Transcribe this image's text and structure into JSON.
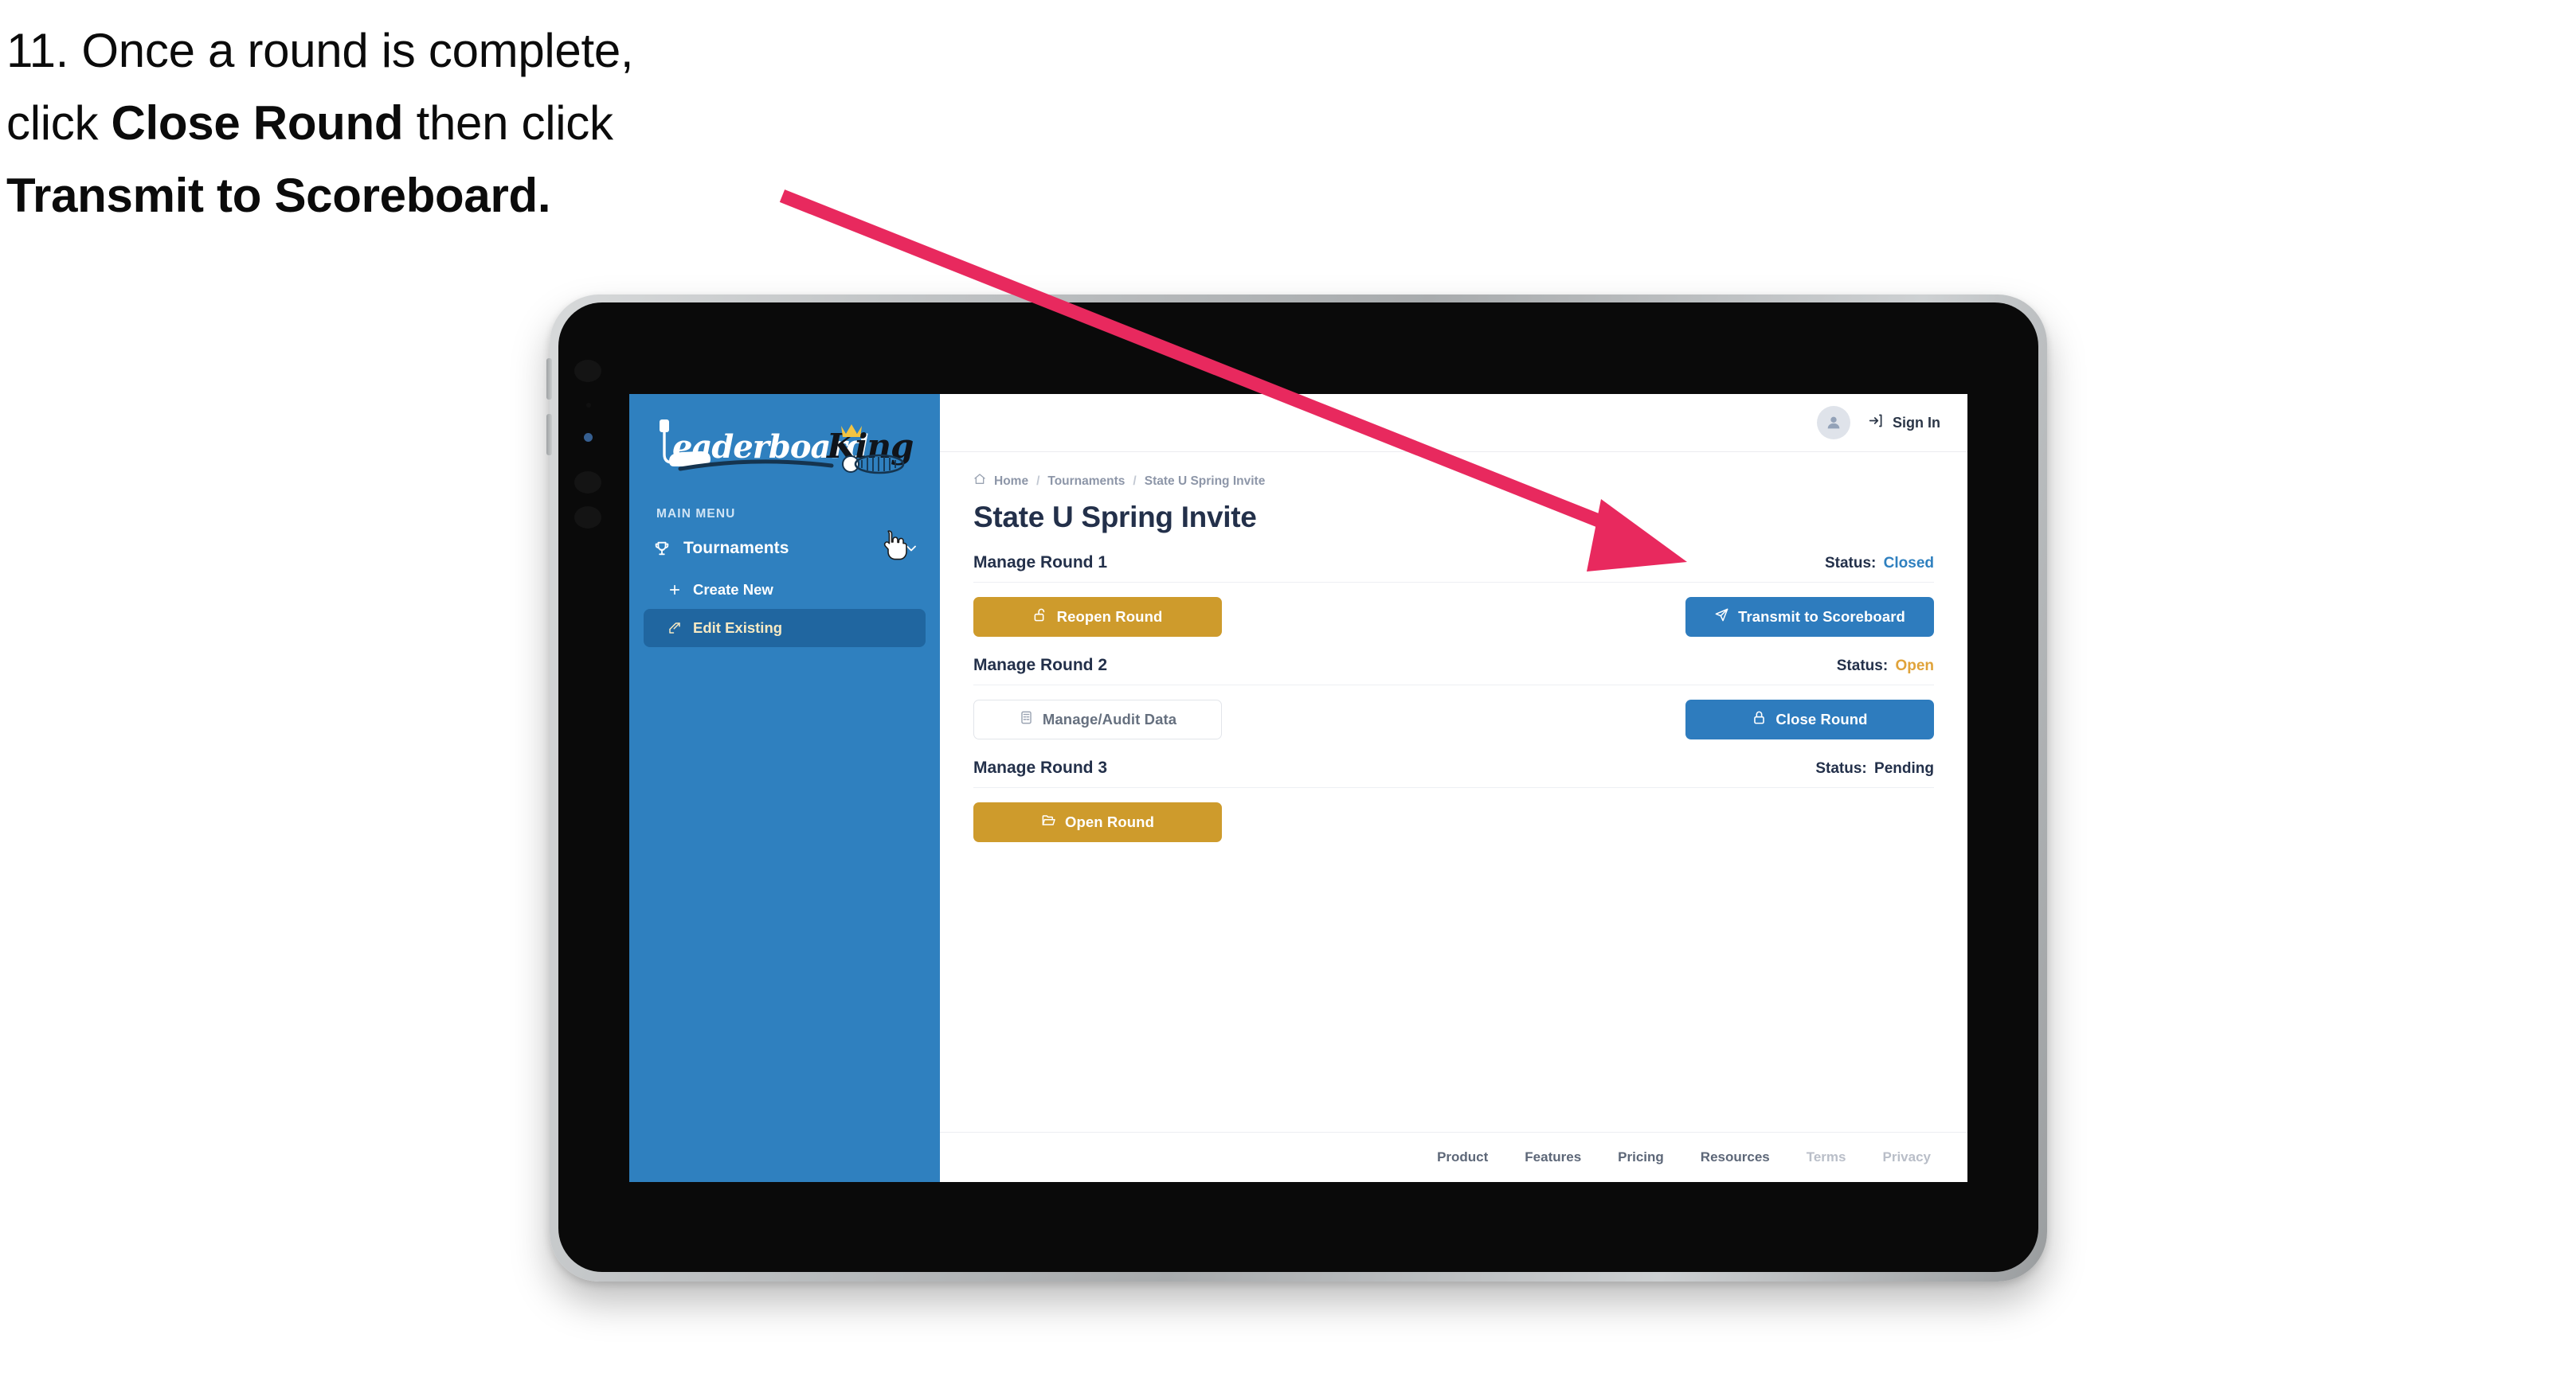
{
  "caption": {
    "line1_pre": "11. Once a round is complete,",
    "line2_pre": "click ",
    "line2_bold": "Close Round",
    "line2_post": " then click",
    "line3_bold": "Transmit to Scoreboard."
  },
  "annotation": {
    "arrow_color": "#e8295e"
  },
  "sidebar": {
    "logo_text_left": "Leaderboard",
    "logo_text_right": "King",
    "section_label": "MAIN MENU",
    "group": {
      "label": "Tournaments",
      "icon": "trophy-icon",
      "chevron": "chevron-down-icon"
    },
    "items": [
      {
        "label": "Create New",
        "icon": "plus-icon",
        "active": false
      },
      {
        "label": "Edit Existing",
        "icon": "edit-pencil-icon",
        "active": true
      }
    ]
  },
  "topbar": {
    "avatar_icon": "user-avatar-icon",
    "signin_icon": "sign-in-icon",
    "signin_label": "Sign In"
  },
  "breadcrumb": {
    "home_icon": "home-icon",
    "items": [
      "Home",
      "Tournaments",
      "State U Spring Invite"
    ],
    "separator": "/"
  },
  "page": {
    "title": "State U Spring Invite"
  },
  "rounds": [
    {
      "title": "Manage Round 1",
      "status_label": "Status:",
      "status_value": "Closed",
      "status_color": "#2f80bf",
      "left_button": {
        "label": "Reopen Round",
        "icon": "unlock-icon",
        "style": "gold"
      },
      "right_button": {
        "label": "Transmit to Scoreboard",
        "icon": "paper-plane-icon",
        "style": "blue"
      }
    },
    {
      "title": "Manage Round 2",
      "status_label": "Status:",
      "status_value": "Open",
      "status_color": "#e0a33a",
      "left_button": {
        "label": "Manage/Audit Data",
        "icon": "clipboard-icon",
        "style": "ghost"
      },
      "right_button": {
        "label": "Close Round",
        "icon": "lock-icon",
        "style": "blue"
      }
    },
    {
      "title": "Manage Round 3",
      "status_label": "Status:",
      "status_value": "Pending",
      "status_color": "#23304a",
      "left_button": {
        "label": "Open Round",
        "icon": "folder-open-icon",
        "style": "gold"
      },
      "right_button": null
    }
  ],
  "footer": {
    "links": [
      {
        "label": "Product",
        "muted": false
      },
      {
        "label": "Features",
        "muted": false
      },
      {
        "label": "Pricing",
        "muted": false
      },
      {
        "label": "Resources",
        "muted": false
      },
      {
        "label": "Terms",
        "muted": true
      },
      {
        "label": "Privacy",
        "muted": true
      }
    ]
  }
}
